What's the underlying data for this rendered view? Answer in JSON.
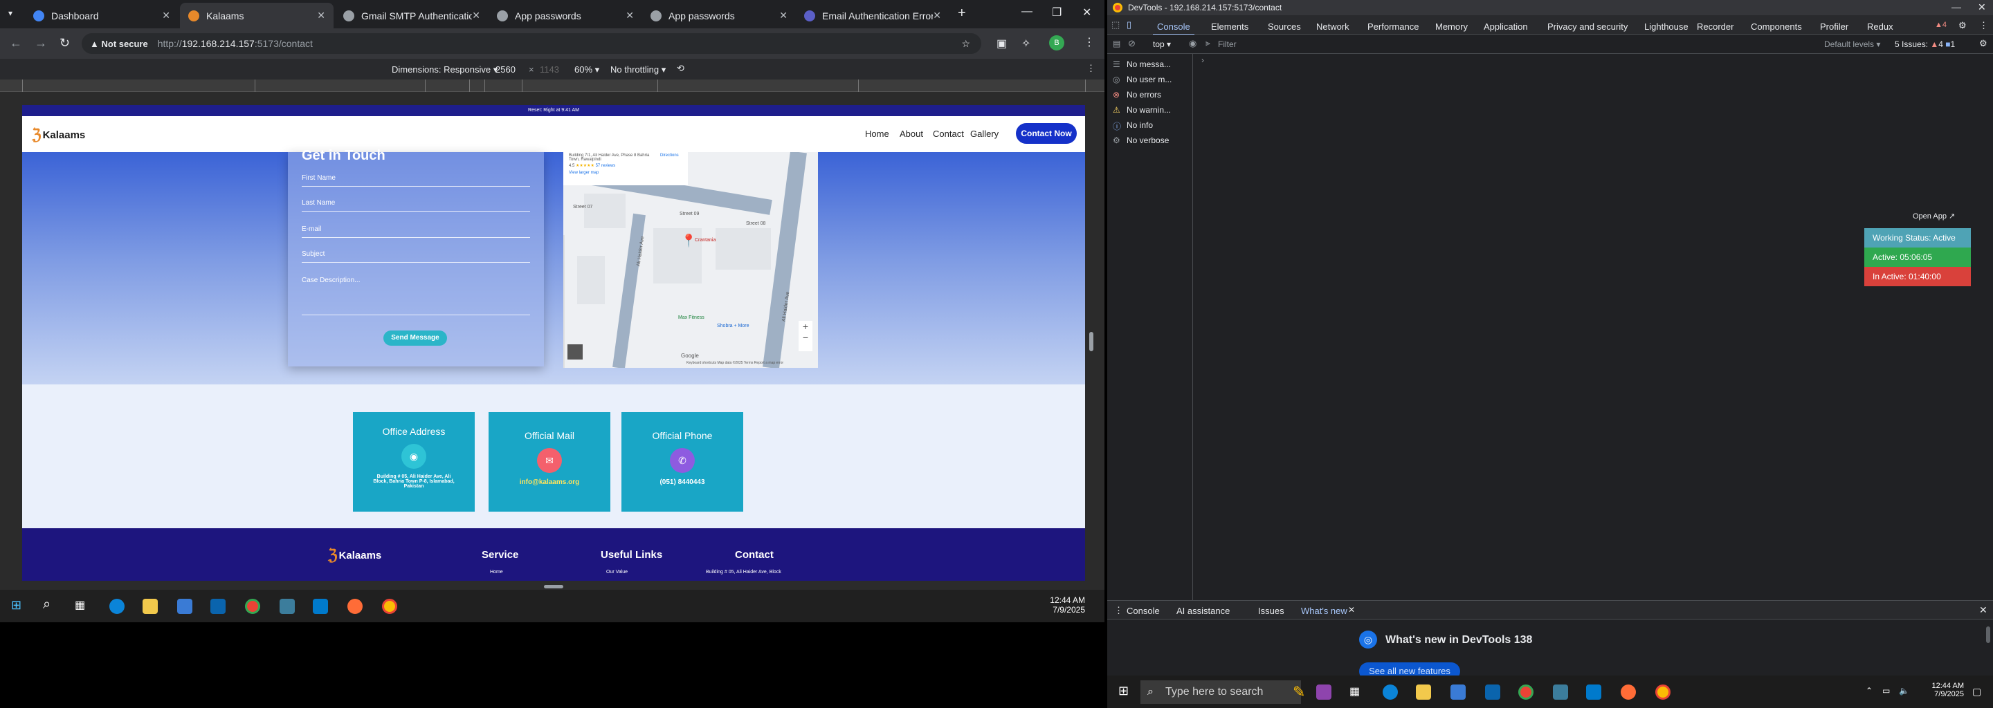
{
  "browser": {
    "tabs": [
      {
        "title": "Dashboard",
        "color": "#4285f4"
      },
      {
        "title": "Kalaams",
        "color": "#e8892a"
      },
      {
        "title": "Gmail SMTP Authentication",
        "color": "#9aa0a6"
      },
      {
        "title": "App passwords",
        "color": "#9aa0a6"
      },
      {
        "title": "App passwords",
        "color": "#9aa0a6"
      },
      {
        "title": "Email Authentication Error",
        "color": "#5b5fc7"
      }
    ],
    "address": {
      "security": "Not secure",
      "url_prefix": "http://",
      "host": "192.168.214.157",
      "path": ":5173/contact"
    },
    "device_toolbar": {
      "dimensions_label": "Dimensions: Responsive",
      "width": "2560",
      "height": "1143",
      "zoom": "60%",
      "throttling": "No throttling"
    }
  },
  "site": {
    "status_bar": "Reset: Right at 9:41 AM",
    "brand": "Kalaams",
    "nav": [
      "Home",
      "About",
      "Contact",
      "Gallery"
    ],
    "cta": "Contact Now",
    "form": {
      "title": "Get in Touch",
      "fields": [
        "First Name",
        "Last Name",
        "E-mail",
        "Subject",
        "Case Description..."
      ],
      "submit": "Send Message"
    },
    "map": {
      "address_snippet": "Building 7/1, Ali Haider Ave, Phase 8 Bahria Town, Rawalpindi",
      "rating": "4.5",
      "reviews": "57 reviews",
      "larger_map": "View larger map",
      "directions": "Directions",
      "pin_label": "Crantania",
      "poi_1": "Max Fitness",
      "poi_2": "Shobra + More",
      "streets": [
        "Street 07",
        "Street 09",
        "Street 08",
        "Ali Haider Ave",
        "Ali Haider Ave"
      ],
      "google": "Google",
      "attribution": "Keyboard shortcuts   Map data ©2025   Terms   Report a map error"
    },
    "cards": [
      {
        "title": "Office Address",
        "value": "Building # 05, Ali Haider Ave, Ali Block, Bahria Town P-8, Islamabad, Pakistan",
        "color": "#2ec4d6"
      },
      {
        "title": "Official Mail",
        "value": "info@kalaams.org",
        "color": "#f4606c"
      },
      {
        "title": "Official Phone",
        "value": "(051) 8440443",
        "color": "#8e5be0"
      }
    ],
    "footer": {
      "brand": "Kalaams",
      "cols": [
        "Service",
        "Useful Links",
        "Contact"
      ],
      "sub": [
        "Home",
        "Our Value",
        "Building # 05, Ali Haider Ave, Block"
      ]
    }
  },
  "taskbar_left": {
    "time": "12:44 AM",
    "date": "7/9/2025"
  },
  "devtools": {
    "window_title": "DevTools - 192.168.214.157:5173/contact",
    "tabs": [
      "Console",
      "Elements",
      "Sources",
      "Network",
      "Performance",
      "Memory",
      "Application",
      "Privacy and security",
      "Lighthouse",
      "Recorder",
      "Components",
      "Profiler",
      "Redux"
    ],
    "context": "top",
    "filter_placeholder": "Filter",
    "levels": "Default levels",
    "issues": "5 Issues:",
    "issue_errors": "4",
    "issue_info": "1",
    "sidebar": [
      {
        "icon": "list-icon",
        "label": "No messa..."
      },
      {
        "icon": "user-icon",
        "label": "No user m..."
      },
      {
        "icon": "error-icon",
        "label": "No errors"
      },
      {
        "icon": "warning-icon",
        "label": "No warnin..."
      },
      {
        "icon": "info-icon",
        "label": "No info"
      },
      {
        "icon": "verbose-icon",
        "label": "No verbose"
      }
    ],
    "widget": {
      "open_app": "Open App ↗",
      "working": "Working Status: Active",
      "active": "Active: 05:06:05",
      "inactive": "In Active: 01:40:00"
    },
    "drawer_tabs": [
      "Console",
      "AI assistance",
      "Issues",
      "What's new"
    ],
    "whatsnew_title": "What's new in DevTools 138",
    "see_all": "See all new features"
  },
  "taskbar_right": {
    "search": "Type here to search",
    "time": "12:44 AM",
    "date": "7/9/2025"
  }
}
